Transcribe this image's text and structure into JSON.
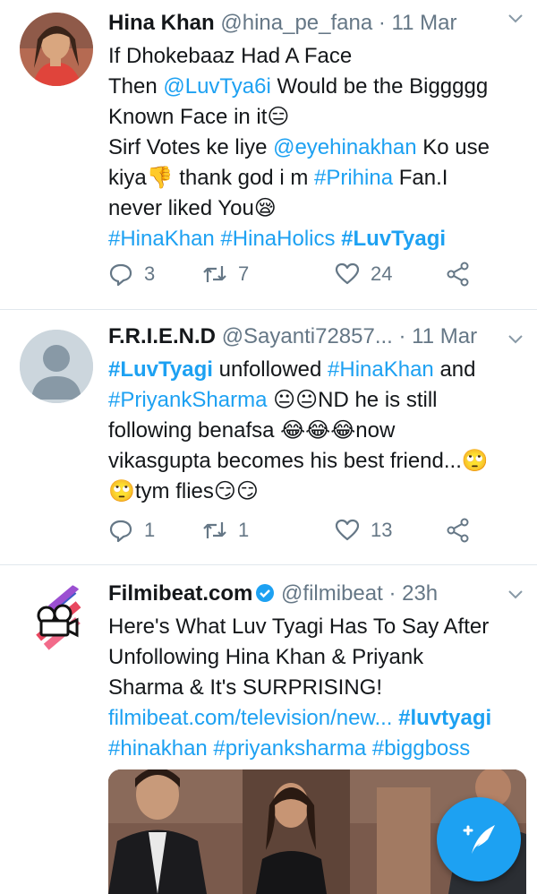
{
  "tweets": [
    {
      "name": "Hina Khan",
      "handle": "@hina_pe_fana",
      "time": "· 11 Mar",
      "lines": [
        {
          "t1": "If Dhokebaaz Had A Face"
        },
        {
          "t1": "Then ",
          "l1": "@LuvTya6i",
          "t2": " Would be the Biggggg"
        },
        {
          "t1": "Known Face in it😑"
        },
        {
          "t1": "Sirf Votes ke liye ",
          "l1": "@eyehinakhan",
          "t2": " Ko use"
        },
        {
          "t1": "kiya👎 thank god i m ",
          "l1": "#Prihina",
          "t2": " Fan.I"
        },
        {
          "t1": "never liked You😪"
        },
        {
          "l1": "#HinaKhan #HinaHolics ",
          "b1": "#LuvTyagi"
        }
      ],
      "replies": "3",
      "retweets": "7",
      "likes": "24"
    },
    {
      "name": "F.R.I.E.N.D",
      "handle": "@Sayanti72857...",
      "time": "· 11 Mar",
      "lines": [
        {
          "b1": "#LuvTyagi",
          "t1": " unfollowed ",
          "l1": "#HinaKhan",
          "t2": " and"
        },
        {
          "l1": "#PriyankSharma",
          "t1": " 😐😐ND he is still"
        },
        {
          "t1": "following benafsa 😂😂😂now"
        },
        {
          "t1": "vikasgupta becomes his best friend...🙄"
        },
        {
          "t1": "🙄tym flies😏😏"
        }
      ],
      "replies": "1",
      "retweets": "1",
      "likes": "13"
    },
    {
      "name": "Filmibeat.com",
      "handle": "@filmibeat",
      "time": "· 23h",
      "lines": [
        {
          "t1": "Here's What Luv Tyagi Has To Say After"
        },
        {
          "t1": "Unfollowing Hina Khan & Priyank"
        },
        {
          "t1": "Sharma & It's SURPRISING!"
        },
        {
          "l1": "filmibeat.com/television/new... ",
          "b1": "#luvtyagi"
        },
        {
          "l1": "#hinakhan #priyanksharma #biggboss"
        }
      ]
    }
  ],
  "icons": {
    "reply": "reply-icon",
    "retweet": "retweet-icon",
    "like": "heart-icon",
    "share": "share-icon",
    "compose": "compose-tweet-icon"
  },
  "colors": {
    "accent": "#1da1f2",
    "muted": "#657786",
    "divider": "#e1e8ed"
  }
}
